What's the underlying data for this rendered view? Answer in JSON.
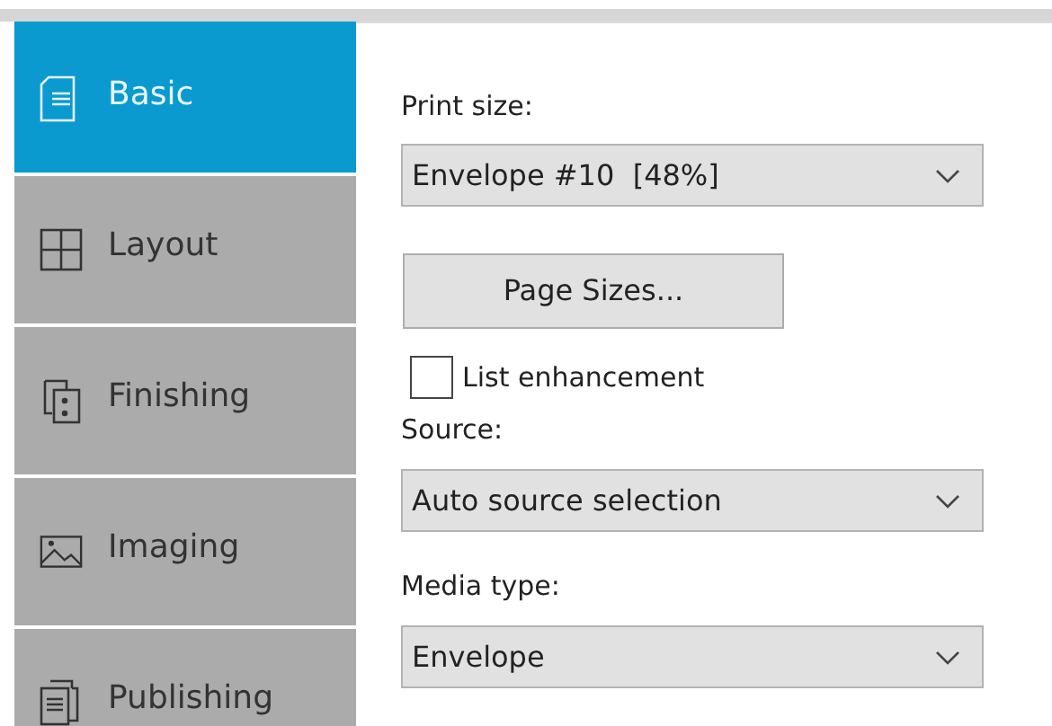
{
  "tabs": [
    {
      "label": "Basic",
      "selected": true
    },
    {
      "label": "Layout",
      "selected": false
    },
    {
      "label": "Finishing",
      "selected": false
    },
    {
      "label": "Imaging",
      "selected": false
    },
    {
      "label": "Publishing",
      "selected": false
    }
  ],
  "print_size": {
    "label": "Print size:",
    "value": "Envelope #10  [48%]"
  },
  "page_sizes_button": "Page Sizes...",
  "list_enhancement": {
    "label": "List enhancement",
    "checked": false
  },
  "source": {
    "label": "Source:",
    "value": "Auto source selection"
  },
  "media_type": {
    "label": "Media type:",
    "value": "Envelope"
  }
}
